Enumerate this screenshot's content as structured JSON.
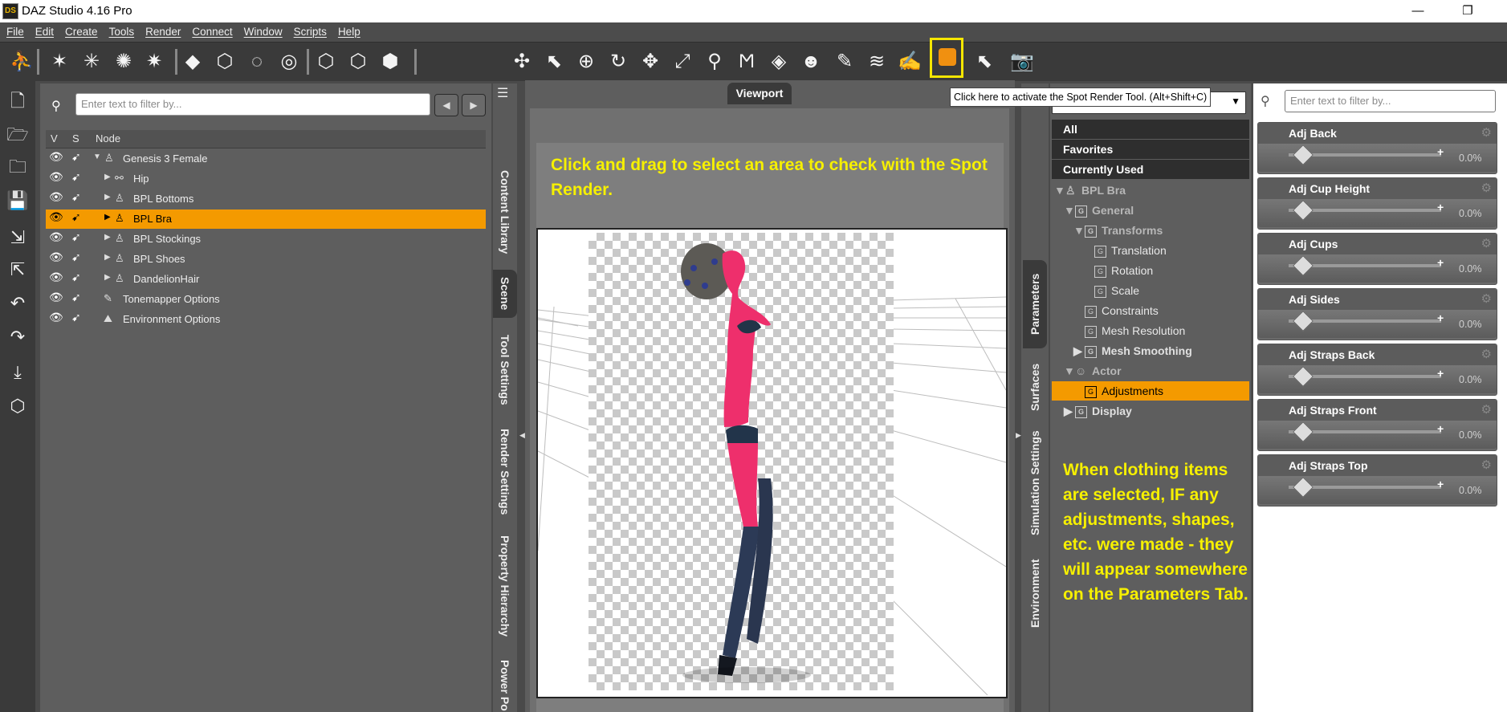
{
  "app": {
    "title": "DAZ Studio 4.16 Pro",
    "logo": "DS"
  },
  "window_buttons": [
    "minimize-icon",
    "maximize-icon"
  ],
  "menu": [
    "File",
    "Edit",
    "Create",
    "Tools",
    "Render",
    "Connect",
    "Window",
    "Scripts",
    "Help"
  ],
  "tooltip": "Click here to activate the Spot Render Tool. (Alt+Shift+C)",
  "scene": {
    "filter_placeholder": "Enter text to filter by...",
    "columns": {
      "v": "V",
      "s": "S",
      "node": "Node"
    },
    "nodes": [
      {
        "label": "Genesis 3 Female",
        "icon": "figure-icon",
        "depth": 0,
        "expanded": true
      },
      {
        "label": "Hip",
        "icon": "bone-icon",
        "depth": 1
      },
      {
        "label": "BPL Bottoms",
        "icon": "figure-icon",
        "depth": 1
      },
      {
        "label": "BPL Bra",
        "icon": "figure-icon",
        "depth": 1,
        "selected": true
      },
      {
        "label": "BPL Stockings",
        "icon": "figure-icon",
        "depth": 1
      },
      {
        "label": "BPL Shoes",
        "icon": "figure-icon",
        "depth": 1
      },
      {
        "label": "DandelionHair",
        "icon": "figure-icon",
        "depth": 1
      },
      {
        "label": "Tonemapper Options",
        "icon": "tonemapper-icon",
        "depth": 0
      },
      {
        "label": "Environment Options",
        "icon": "environment-icon",
        "depth": 0
      }
    ]
  },
  "left_tabs": [
    "Content Library",
    "Scene",
    "Tool Settings",
    "Render Settings",
    "Property Hierarchy",
    "Power Po"
  ],
  "left_tabs_active": "Scene",
  "viewport": {
    "tab_label": "Viewport",
    "instruction": "Click and drag to select an area to check with the Spot Render."
  },
  "right_tabs": [
    "Parameters",
    "Surfaces",
    "Simulation Settings",
    "Environment"
  ],
  "right_tabs_active": "Parameters",
  "param_tree": [
    {
      "label": "All",
      "style": "hdr"
    },
    {
      "label": "Favorites",
      "style": "hdr"
    },
    {
      "label": "Currently Used",
      "style": "hdr"
    },
    {
      "label": "BPL Bra",
      "style": "grey",
      "depth": 0,
      "arrow": "▼",
      "icon": "figure"
    },
    {
      "label": "General",
      "style": "grey",
      "depth": 1,
      "arrow": "▼",
      "icon": "G"
    },
    {
      "label": "Transforms",
      "style": "grey",
      "depth": 2,
      "arrow": "▼",
      "icon": "G"
    },
    {
      "label": "Translation",
      "style": "",
      "depth": 3,
      "icon": "G"
    },
    {
      "label": "Rotation",
      "style": "",
      "depth": 3,
      "icon": "G"
    },
    {
      "label": "Scale",
      "style": "",
      "depth": 3,
      "icon": "G"
    },
    {
      "label": "Constraints",
      "style": "",
      "depth": 2,
      "icon": "G"
    },
    {
      "label": "Mesh Resolution",
      "style": "",
      "depth": 2,
      "icon": "G"
    },
    {
      "label": "Mesh Smoothing",
      "style": "grey",
      "depth": 2,
      "arrow": "▶",
      "icon": "G"
    },
    {
      "label": "Actor",
      "style": "grey",
      "depth": 1,
      "arrow": "▼",
      "icon": "actor"
    },
    {
      "label": "Adjustments",
      "style": "selected",
      "depth": 2,
      "icon": "G"
    },
    {
      "label": "Display",
      "style": "grey",
      "depth": 1,
      "arrow": "▶",
      "icon": "G"
    }
  ],
  "param_note": "When clothing items are selected, IF any adjustments, shapes, etc. were made - they will appear somewhere on the Parameters Tab.",
  "params": {
    "filter_placeholder": "Enter text to filter by...",
    "sliders": [
      {
        "name": "Adj Back",
        "value": "0.0%"
      },
      {
        "name": "Adj Cup Height",
        "value": "0.0%"
      },
      {
        "name": "Adj Cups",
        "value": "0.0%"
      },
      {
        "name": "Adj Sides",
        "value": "0.0%"
      },
      {
        "name": "Adj Straps Back",
        "value": "0.0%"
      },
      {
        "name": "Adj Straps Front",
        "value": "0.0%"
      },
      {
        "name": "Adj Straps Top",
        "value": "0.0%"
      }
    ]
  },
  "colors": {
    "accent": "#f49a00",
    "highlight": "#f5e600",
    "instruction_text": "#f6f000"
  }
}
